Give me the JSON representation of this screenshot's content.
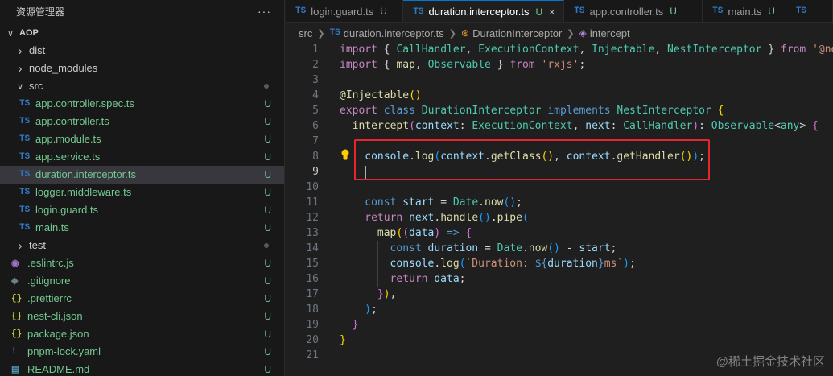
{
  "sidebar": {
    "title": "资源管理器",
    "more": "···",
    "root": "AOP",
    "items": [
      {
        "label": "dist",
        "kind": "folder",
        "expanded": false,
        "indent": 1
      },
      {
        "label": "node_modules",
        "kind": "folder",
        "expanded": false,
        "indent": 1
      },
      {
        "label": "src",
        "kind": "folder",
        "expanded": true,
        "indent": 1,
        "dot": true
      },
      {
        "label": "app.controller.spec.ts",
        "kind": "ts",
        "indent": 2,
        "status": "U"
      },
      {
        "label": "app.controller.ts",
        "kind": "ts",
        "indent": 2,
        "status": "U"
      },
      {
        "label": "app.module.ts",
        "kind": "ts",
        "indent": 2,
        "status": "U"
      },
      {
        "label": "app.service.ts",
        "kind": "ts",
        "indent": 2,
        "status": "U"
      },
      {
        "label": "duration.interceptor.ts",
        "kind": "ts",
        "indent": 2,
        "status": "U",
        "selected": true
      },
      {
        "label": "logger.middleware.ts",
        "kind": "ts",
        "indent": 2,
        "status": "U"
      },
      {
        "label": "login.guard.ts",
        "kind": "ts",
        "indent": 2,
        "status": "U"
      },
      {
        "label": "main.ts",
        "kind": "ts",
        "indent": 2,
        "status": "U"
      },
      {
        "label": "test",
        "kind": "folder",
        "expanded": false,
        "indent": 1,
        "dot": true
      },
      {
        "label": ".eslintrc.js",
        "kind": "eslint",
        "indent": 1,
        "status": "U"
      },
      {
        "label": ".gitignore",
        "kind": "git",
        "indent": 1,
        "status": "U"
      },
      {
        "label": ".prettierrc",
        "kind": "json",
        "indent": 1,
        "status": "U"
      },
      {
        "label": "nest-cli.json",
        "kind": "json",
        "indent": 1,
        "status": "U"
      },
      {
        "label": "package.json",
        "kind": "json",
        "indent": 1,
        "status": "U"
      },
      {
        "label": "pnpm-lock.yaml",
        "kind": "yaml",
        "indent": 1,
        "status": "U"
      },
      {
        "label": "README.md",
        "kind": "md",
        "indent": 1,
        "status": "U"
      }
    ]
  },
  "tabs": [
    {
      "label": "login.guard.ts",
      "mark": "TS",
      "status": "U",
      "active": false
    },
    {
      "label": "duration.interceptor.ts",
      "mark": "TS",
      "status": "U",
      "active": true,
      "close": "×"
    },
    {
      "label": "app.controller.ts",
      "mark": "TS",
      "status": "U",
      "active": false
    },
    {
      "label": "main.ts",
      "mark": "TS",
      "status": "U",
      "active": false
    },
    {
      "label": "",
      "mark": "TS",
      "status": "",
      "active": false
    }
  ],
  "breadcrumb": {
    "folder": "src",
    "file": "duration.interceptor.ts",
    "file_mark": "TS",
    "class": "DurationInterceptor",
    "method": "intercept"
  },
  "editor": {
    "current_line": 9,
    "lines": [
      {
        "n": "1",
        "indent": 0,
        "tokens": [
          [
            "k",
            "import "
          ],
          [
            "p",
            "{ "
          ],
          [
            "c",
            "CallHandler"
          ],
          [
            "p",
            ", "
          ],
          [
            "c",
            "ExecutionContext"
          ],
          [
            "p",
            ", "
          ],
          [
            "c",
            "Injectable"
          ],
          [
            "p",
            ", "
          ],
          [
            "c",
            "NestInterceptor"
          ],
          [
            "p",
            " } "
          ],
          [
            "k",
            "from "
          ],
          [
            "s",
            "'@nes"
          ]
        ]
      },
      {
        "n": "2",
        "indent": 0,
        "tokens": [
          [
            "k",
            "import "
          ],
          [
            "p",
            "{ "
          ],
          [
            "f",
            "map"
          ],
          [
            "p",
            ", "
          ],
          [
            "c",
            "Observable"
          ],
          [
            "p",
            " } "
          ],
          [
            "k",
            "from "
          ],
          [
            "s",
            "'rxjs'"
          ],
          [
            "p",
            ";"
          ]
        ]
      },
      {
        "n": "3",
        "indent": 0,
        "tokens": []
      },
      {
        "n": "4",
        "indent": 0,
        "tokens": [
          [
            "d",
            "@Injectable"
          ],
          [
            "br1",
            "()"
          ]
        ]
      },
      {
        "n": "5",
        "indent": 0,
        "tokens": [
          [
            "k",
            "export "
          ],
          [
            "kb",
            "class "
          ],
          [
            "c",
            "DurationInterceptor "
          ],
          [
            "kb",
            "implements "
          ],
          [
            "c",
            "NestInterceptor "
          ],
          [
            "br1",
            "{"
          ]
        ]
      },
      {
        "n": "6",
        "indent": 1,
        "tokens": [
          [
            "f",
            "intercept"
          ],
          [
            "br2",
            "("
          ],
          [
            "v",
            "context"
          ],
          [
            "p",
            ": "
          ],
          [
            "c",
            "ExecutionContext"
          ],
          [
            "p",
            ", "
          ],
          [
            "v",
            "next"
          ],
          [
            "p",
            ": "
          ],
          [
            "c",
            "CallHandler"
          ],
          [
            "br2",
            ")"
          ],
          [
            "p",
            ": "
          ],
          [
            "c",
            "Observable"
          ],
          [
            "p",
            "<"
          ],
          [
            "c",
            "any"
          ],
          [
            "p",
            "> "
          ],
          [
            "br2",
            "{"
          ]
        ]
      },
      {
        "n": "7",
        "indent": 0,
        "tokens": []
      },
      {
        "n": "8",
        "indent": 2,
        "tokens": [
          [
            "v",
            "console"
          ],
          [
            "p",
            "."
          ],
          [
            "f",
            "log"
          ],
          [
            "br3",
            "("
          ],
          [
            "v",
            "context"
          ],
          [
            "p",
            "."
          ],
          [
            "f",
            "getClass"
          ],
          [
            "br1",
            "()"
          ],
          [
            "p",
            ", "
          ],
          [
            "v",
            "context"
          ],
          [
            "p",
            "."
          ],
          [
            "f",
            "getHandler"
          ],
          [
            "br1",
            "()"
          ],
          [
            "br3",
            ")"
          ],
          [
            "p",
            ";"
          ]
        ]
      },
      {
        "n": "9",
        "indent": 2,
        "tokens": []
      },
      {
        "n": "10",
        "indent": 0,
        "tokens": []
      },
      {
        "n": "11",
        "indent": 2,
        "tokens": [
          [
            "kb",
            "const "
          ],
          [
            "v",
            "start "
          ],
          [
            "p",
            "= "
          ],
          [
            "c",
            "Date"
          ],
          [
            "p",
            "."
          ],
          [
            "f",
            "now"
          ],
          [
            "br3",
            "()"
          ],
          [
            "p",
            ";"
          ]
        ]
      },
      {
        "n": "12",
        "indent": 2,
        "tokens": [
          [
            "k",
            "return "
          ],
          [
            "v",
            "next"
          ],
          [
            "p",
            "."
          ],
          [
            "f",
            "handle"
          ],
          [
            "br3",
            "()"
          ],
          [
            "p",
            "."
          ],
          [
            "f",
            "pipe"
          ],
          [
            "br3",
            "("
          ]
        ]
      },
      {
        "n": "13",
        "indent": 3,
        "tokens": [
          [
            "f",
            "map"
          ],
          [
            "br1",
            "("
          ],
          [
            "br2",
            "("
          ],
          [
            "v",
            "data"
          ],
          [
            "br2",
            ")"
          ],
          [
            "p",
            " "
          ],
          [
            "kb",
            "=>"
          ],
          [
            "p",
            " "
          ],
          [
            "br2",
            "{"
          ]
        ]
      },
      {
        "n": "14",
        "indent": 4,
        "tokens": [
          [
            "kb",
            "const "
          ],
          [
            "v",
            "duration "
          ],
          [
            "p",
            "= "
          ],
          [
            "c",
            "Date"
          ],
          [
            "p",
            "."
          ],
          [
            "f",
            "now"
          ],
          [
            "br3",
            "()"
          ],
          [
            "p",
            " - "
          ],
          [
            "v",
            "start"
          ],
          [
            "p",
            ";"
          ]
        ]
      },
      {
        "n": "15",
        "indent": 4,
        "tokens": [
          [
            "v",
            "console"
          ],
          [
            "p",
            "."
          ],
          [
            "f",
            "log"
          ],
          [
            "br3",
            "("
          ],
          [
            "s",
            "`Duration: "
          ],
          [
            "kb",
            "${"
          ],
          [
            "v",
            "duration"
          ],
          [
            "kb",
            "}"
          ],
          [
            "s",
            "ms`"
          ],
          [
            "br3",
            ")"
          ],
          [
            "p",
            ";"
          ]
        ]
      },
      {
        "n": "16",
        "indent": 4,
        "tokens": [
          [
            "k",
            "return "
          ],
          [
            "v",
            "data"
          ],
          [
            "p",
            ";"
          ]
        ]
      },
      {
        "n": "17",
        "indent": 3,
        "tokens": [
          [
            "br2",
            "}"
          ],
          [
            "br1",
            ")"
          ],
          [
            "p",
            ","
          ]
        ]
      },
      {
        "n": "18",
        "indent": 2,
        "tokens": [
          [
            "br3",
            ")"
          ],
          [
            "p",
            ";"
          ]
        ]
      },
      {
        "n": "19",
        "indent": 1,
        "tokens": [
          [
            "br2",
            "}"
          ]
        ]
      },
      {
        "n": "20",
        "indent": 0,
        "tokens": [
          [
            "br1",
            "}"
          ]
        ]
      },
      {
        "n": "21",
        "indent": 0,
        "tokens": []
      }
    ]
  },
  "watermark": "@稀土掘金技术社区",
  "colors": {
    "accent": "#0078d4",
    "untracked": "#73c991",
    "highlight_box": "#e8262d",
    "ts_icon": "#3178c6"
  }
}
